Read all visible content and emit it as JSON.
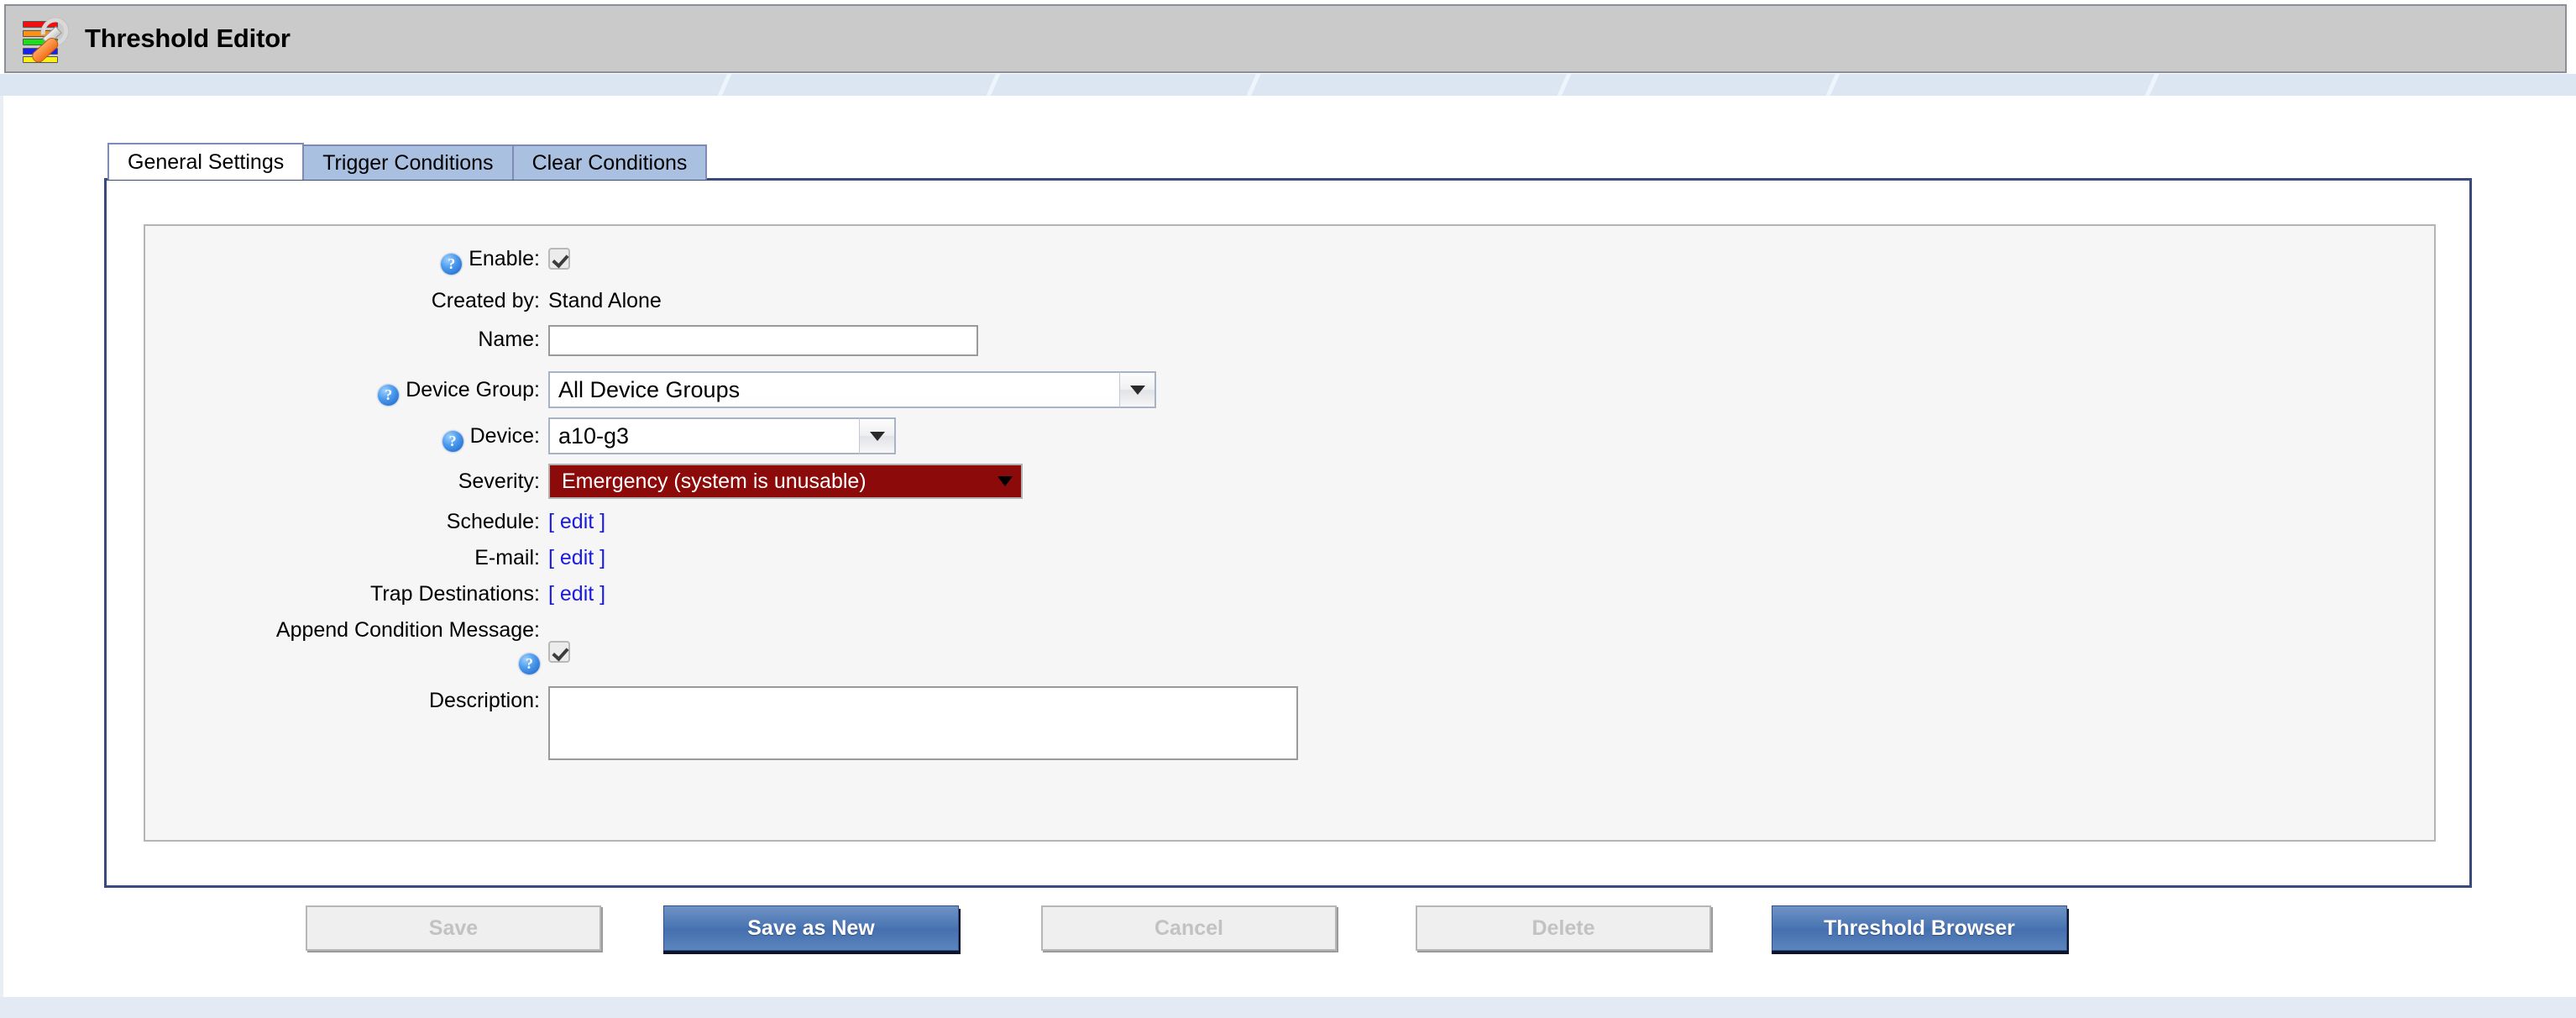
{
  "window": {
    "title": "Threshold Editor",
    "icon": "threshold-bars-wrench-icon"
  },
  "tabs": [
    {
      "label": "General Settings",
      "active": true
    },
    {
      "label": "Trigger Conditions",
      "active": false
    },
    {
      "label": "Clear Conditions",
      "active": false
    }
  ],
  "form": {
    "help_glyph": "?",
    "enable": {
      "label": "Enable:",
      "checked": true,
      "has_help": true
    },
    "created_by": {
      "label": "Created by:",
      "value": "Stand Alone"
    },
    "name": {
      "label": "Name:",
      "value": "",
      "placeholder": ""
    },
    "device_group": {
      "label": "Device Group:",
      "value": "All Device Groups",
      "has_help": true,
      "arrow": "▼"
    },
    "device": {
      "label": "Device:",
      "value": "a10-g3",
      "has_help": true,
      "arrow": "▼"
    },
    "severity": {
      "label": "Severity:",
      "value": "Emergency (system is unusable)",
      "color": "#8c0a0a",
      "text_color": "#ffffff",
      "arrow": "▼"
    },
    "schedule": {
      "label": "Schedule:",
      "link": "[ edit ]"
    },
    "email": {
      "label": "E-mail:",
      "link": "[ edit ]"
    },
    "trap_destinations": {
      "label": "Trap Destinations:",
      "link": "[ edit ]"
    },
    "append_condition_message": {
      "label": "Append Condition Message:",
      "checked": true,
      "has_help": true
    },
    "description": {
      "label": "Description:",
      "value": "",
      "placeholder": ""
    }
  },
  "buttons": {
    "save": {
      "label": "Save",
      "enabled": false
    },
    "save_as_new": {
      "label": "Save as New",
      "enabled": true
    },
    "cancel": {
      "label": "Cancel",
      "enabled": false
    },
    "delete": {
      "label": "Delete",
      "enabled": false
    },
    "threshold_browser": {
      "label": "Threshold Browser",
      "enabled": true
    }
  },
  "colors": {
    "titlebar_bg": "#cacaca",
    "band_bg": "#dce6f2",
    "tab_active_bg": "#ffffff",
    "tab_inactive_bg": "#a9c0e0",
    "panel_border": "#3b4a7d",
    "severity_red": "#8c0a0a",
    "primary_button": "#4a76b4",
    "link_blue": "#1a1ae0"
  }
}
